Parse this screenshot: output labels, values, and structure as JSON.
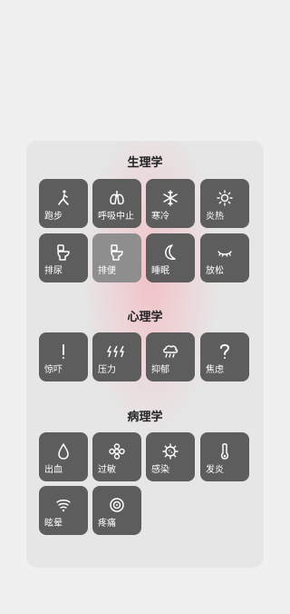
{
  "sections": [
    {
      "title": "生理学",
      "items": [
        {
          "label": "跑步",
          "icon": "runner-icon"
        },
        {
          "label": "呼吸中止",
          "icon": "lungs-icon"
        },
        {
          "label": "寒冷",
          "icon": "snowflake-icon"
        },
        {
          "label": "炎热",
          "icon": "sun-icon"
        },
        {
          "label": "排尿",
          "icon": "toilet-icon"
        },
        {
          "label": "排便",
          "icon": "toilet-icon"
        },
        {
          "label": "睡眠",
          "icon": "moon-icon"
        },
        {
          "label": "放松",
          "icon": "closed-eye-icon"
        }
      ]
    },
    {
      "title": "心理学",
      "items": [
        {
          "label": "惊吓",
          "icon": "exclamation-icon"
        },
        {
          "label": "压力",
          "icon": "lightning-icon"
        },
        {
          "label": "抑郁",
          "icon": "rain-cloud-icon"
        },
        {
          "label": "焦虑",
          "icon": "question-icon"
        }
      ]
    },
    {
      "title": "病理学",
      "items": [
        {
          "label": "出血",
          "icon": "drop-icon"
        },
        {
          "label": "过敏",
          "icon": "flower-icon"
        },
        {
          "label": "感染",
          "icon": "virus-icon"
        },
        {
          "label": "发炎",
          "icon": "thermometer-icon"
        },
        {
          "label": "眩晕",
          "icon": "dizzy-icon"
        },
        {
          "label": "疼痛",
          "icon": "pain-target-icon"
        }
      ]
    }
  ],
  "colors": {
    "background": "#f0f0f0",
    "panel": "#e6e6e6",
    "tile": "#5d5d5d",
    "tile_selected": "#8e8e8e",
    "glow": "#ff96a0"
  }
}
